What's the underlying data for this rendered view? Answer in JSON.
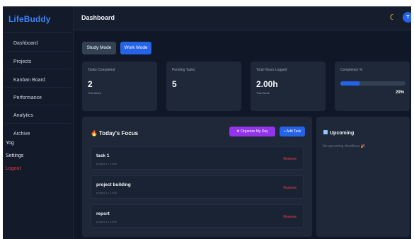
{
  "app": {
    "brand": "LifeBuddy",
    "page_title": "Dashboard",
    "avatar_initial": "T"
  },
  "sidebar": {
    "items": [
      {
        "label": "Dashboard"
      },
      {
        "label": "Projects"
      },
      {
        "label": "Kanban Board"
      },
      {
        "label": "Performance"
      },
      {
        "label": "Analytics"
      },
      {
        "label": "Archive"
      }
    ],
    "util": {
      "yog": "Yog",
      "settings": "Settings",
      "logout": "Logout"
    }
  },
  "modes": {
    "study": "Study Mode",
    "work": "Work Mode",
    "active": "work"
  },
  "stats": {
    "tasks_completed": {
      "label": "Tasks Completed",
      "value": "2",
      "sub": "This Week"
    },
    "pending_tasks": {
      "label": "Pending Tasks",
      "value": "5"
    },
    "hours_logged": {
      "label": "Total Hours Logged",
      "value": "2.00h",
      "sub": "This Week"
    },
    "completion": {
      "label": "Completion %",
      "value": "29%",
      "fraction": 0.29
    }
  },
  "focus": {
    "title": "Today's Focus",
    "organize_button": "⚙ Organize My Day",
    "add_button": "+ Add Task",
    "tasks": [
      {
        "title": "task 1",
        "meta": "project 1 • 1.00h",
        "remove": "Remove"
      },
      {
        "title": "project building",
        "meta": "project 1 • 1.00h",
        "remove": "Remove"
      },
      {
        "title": "report",
        "meta": "project 1 • 1.00h",
        "remove": "Remove"
      }
    ]
  },
  "upcoming": {
    "title": "Upcoming",
    "empty_text": "No upcoming deadlines 🎉"
  },
  "colors": {
    "accent": "#2563eb",
    "brand": "#3b82f6",
    "organize": "#9333ea",
    "danger": "#ef4444",
    "background": "#101827",
    "card": "#1e2838"
  },
  "icons": {
    "theme_toggle": "moon-icon",
    "focus": "flame-icon",
    "upcoming": "calendar-icon"
  }
}
